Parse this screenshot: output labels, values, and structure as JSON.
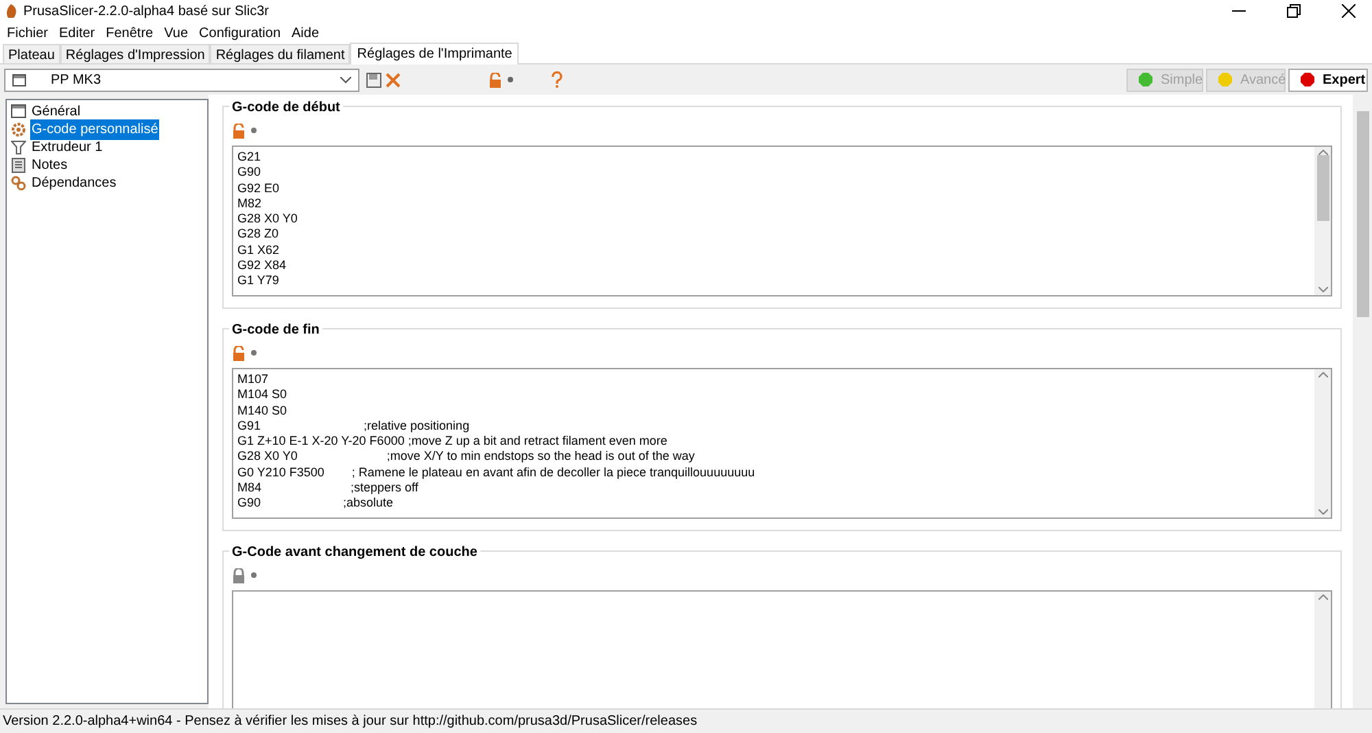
{
  "window": {
    "title": "PrusaSlicer-2.2.0-alpha4 basé sur Slic3r"
  },
  "menu": [
    "Fichier",
    "Editer",
    "Fenêtre",
    "Vue",
    "Configuration",
    "Aide"
  ],
  "tabs": [
    {
      "label": "Plateau",
      "selected": false
    },
    {
      "label": "Réglages d'Impression",
      "selected": false
    },
    {
      "label": "Réglages du filament",
      "selected": false
    },
    {
      "label": "Réglages de l'Imprimante",
      "selected": true
    }
  ],
  "preset": {
    "value": "PP MK3"
  },
  "modes": [
    {
      "label": "Simple",
      "color": "#44bb33",
      "selected": false
    },
    {
      "label": "Avancé",
      "color": "#eecc00",
      "selected": false
    },
    {
      "label": "Expert",
      "color": "#dd0000",
      "selected": true
    }
  ],
  "sidebar": {
    "items": [
      {
        "label": "Général",
        "kind": "window",
        "selected": false
      },
      {
        "label": "G-code personnalisé",
        "kind": "gear",
        "selected": true
      },
      {
        "label": "Extrudeur 1",
        "kind": "funnel",
        "selected": false
      },
      {
        "label": "Notes",
        "kind": "notes",
        "selected": false
      },
      {
        "label": "Dépendances",
        "kind": "links",
        "selected": false
      }
    ]
  },
  "sections": [
    {
      "title": "G-code de début",
      "locked": false,
      "lines": [
        "G21",
        "G90",
        "G92 E0",
        "M82",
        "G28 X0 Y0",
        "G28 Z0",
        "G1 X62",
        "G92 X84",
        "G1 Y79"
      ]
    },
    {
      "title": "G-code de fin",
      "locked": false,
      "lines": [
        "M107",
        "M104 S0",
        "M140 S0",
        "G91                              ;relative positioning",
        "G1 Z+10 E-1 X-20 Y-20 F6000 ;move Z up a bit and retract filament even more",
        "G28 X0 Y0                          ;move X/Y to min endstops so the head is out of the way",
        "G0 Y210 F3500        ; Ramene le plateau en avant afin de decoller la piece tranquillouuuuuuuu",
        "M84                          ;steppers off",
        "G90                        ;absolute"
      ]
    },
    {
      "title": "G-Code avant changement de couche",
      "locked": true
    }
  ],
  "status_bar": "Version 2.2.0-alpha4+win64 - Pensez à vérifier les mises à jour sur http://github.com/prusa3d/PrusaSlicer/releases"
}
